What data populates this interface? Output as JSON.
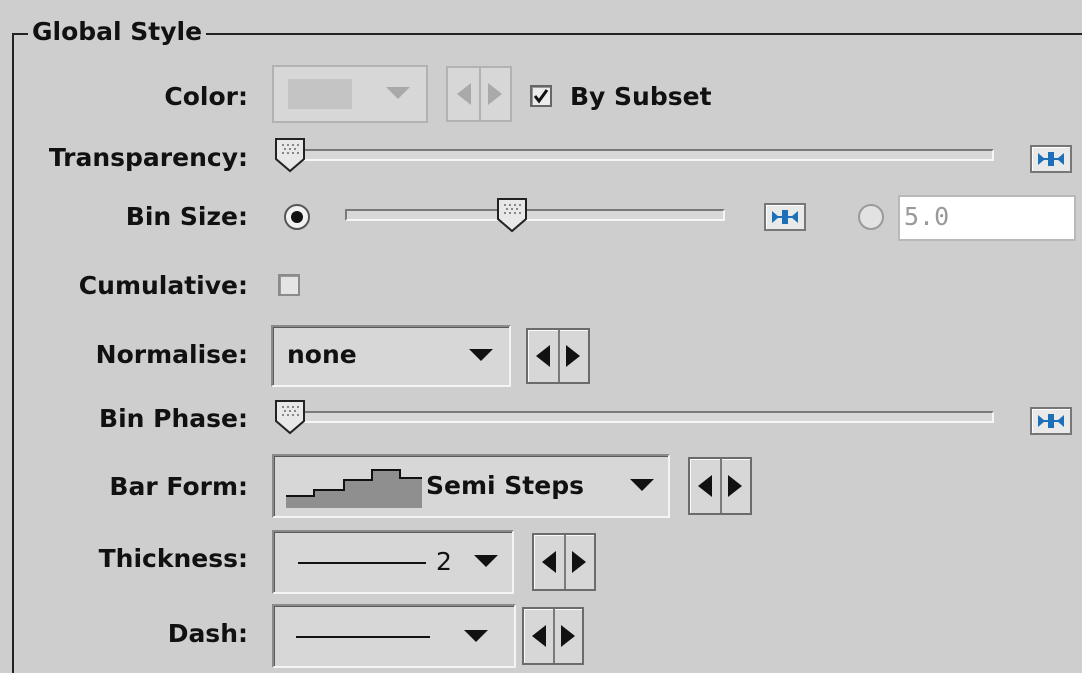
{
  "panel": {
    "title": "Global Style"
  },
  "labels": {
    "color": "Color:",
    "transparency": "Transparency:",
    "bin_size": "Bin Size:",
    "cumulative": "Cumulative:",
    "normalise": "Normalise:",
    "bin_phase": "Bin Phase:",
    "bar_form": "Bar Form:",
    "thickness": "Thickness:",
    "dash": "Dash:"
  },
  "color": {
    "by_subset_label": "By Subset",
    "by_subset_checked": true,
    "enabled": false,
    "swatch": "#c4c4c4"
  },
  "transparency": {
    "level": 0.0
  },
  "bin_size": {
    "slider_selected": true,
    "level": 0.45,
    "text_value": "5.0"
  },
  "cumulative": {
    "checked": false
  },
  "normalise": {
    "value": "none"
  },
  "bin_phase": {
    "level": 0.0
  },
  "bar_form": {
    "value": "Semi Steps",
    "icon": "semi-steps-icon",
    "fill": "#8f8f8f"
  },
  "thickness": {
    "value": "2"
  },
  "dash": {
    "icon": "solid-line-icon"
  },
  "colors": {
    "background": "#cecece",
    "accent_blue": "#1d6fb8"
  }
}
